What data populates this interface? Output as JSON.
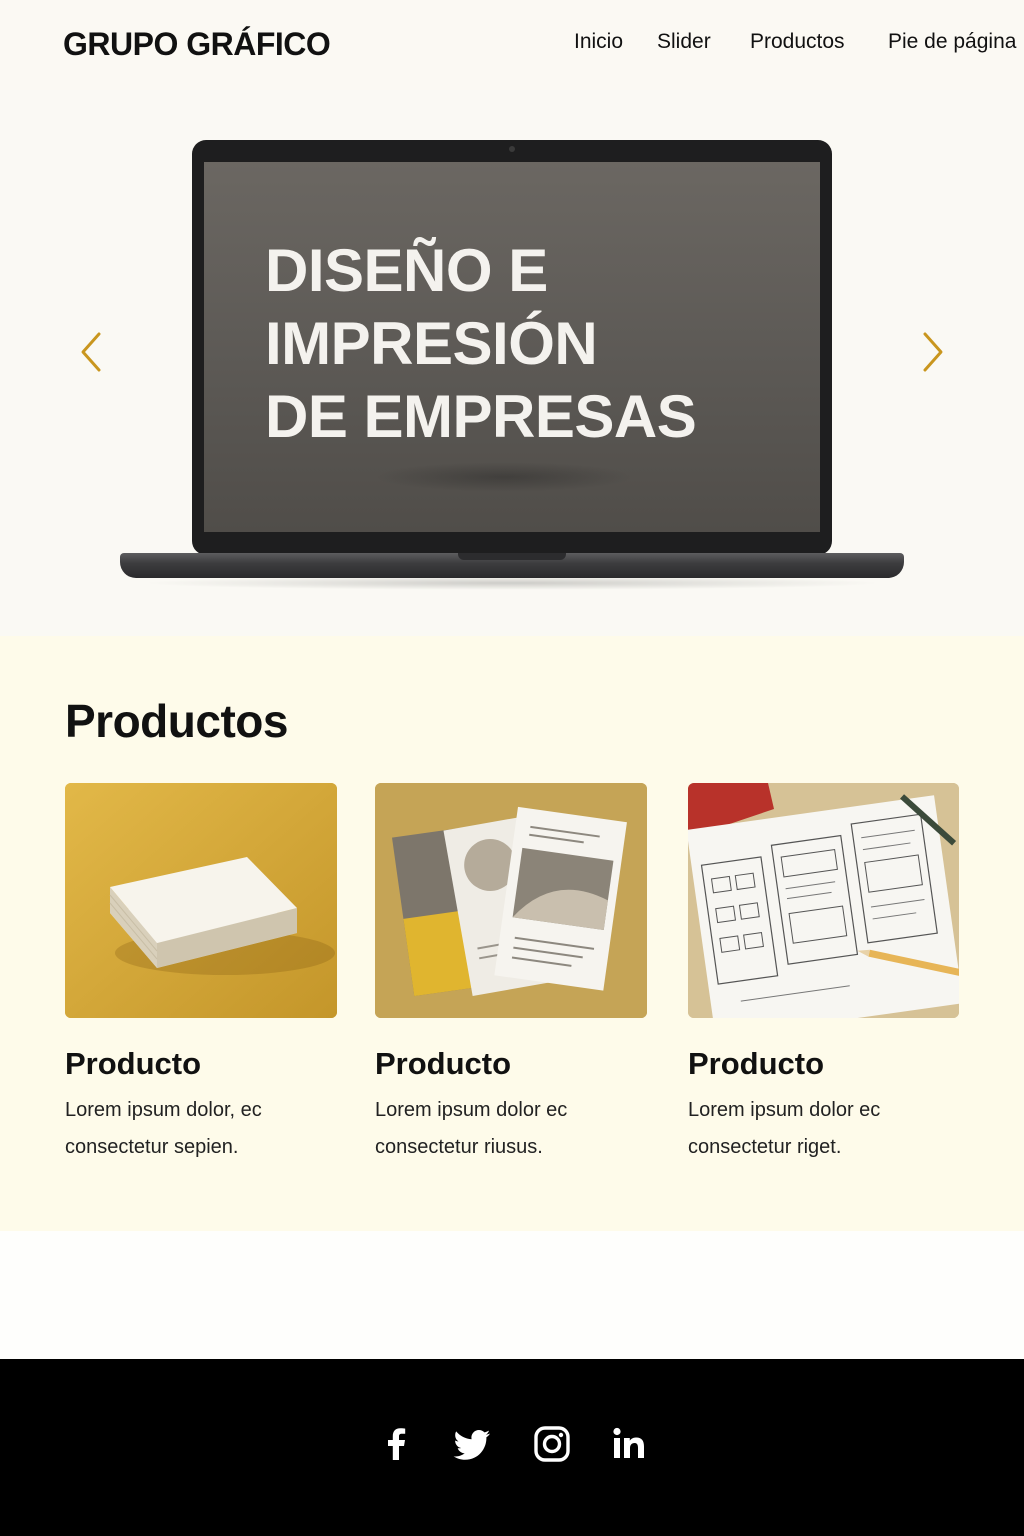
{
  "header": {
    "brand": "GRUPO GRÁFICO",
    "nav": [
      "Inicio",
      "Slider",
      "Productos",
      "Pie de página"
    ]
  },
  "hero": {
    "title_lines": [
      "DISEÑO E",
      "IMPRESIÓN",
      "DE EMPRESAS"
    ],
    "prev_icon": "chevron-left-icon",
    "next_icon": "chevron-right-icon",
    "accent_color": "#c9961e"
  },
  "products": {
    "title": "Productos",
    "items": [
      {
        "name": "Producto",
        "description": "Lorem ipsum dolor, ec consectetur sepien.",
        "image": "business-cards-image"
      },
      {
        "name": "Producto",
        "description": "Lorem ipsum dolor ec consectetur riusus.",
        "image": "brochures-image"
      },
      {
        "name": "Producto",
        "description": "Lorem ipsum dolor ec consectetur riget.",
        "image": "wireframe-sketch-image"
      }
    ]
  },
  "footer": {
    "social": [
      "facebook-icon",
      "twitter-icon",
      "instagram-icon",
      "linkedin-icon"
    ]
  }
}
